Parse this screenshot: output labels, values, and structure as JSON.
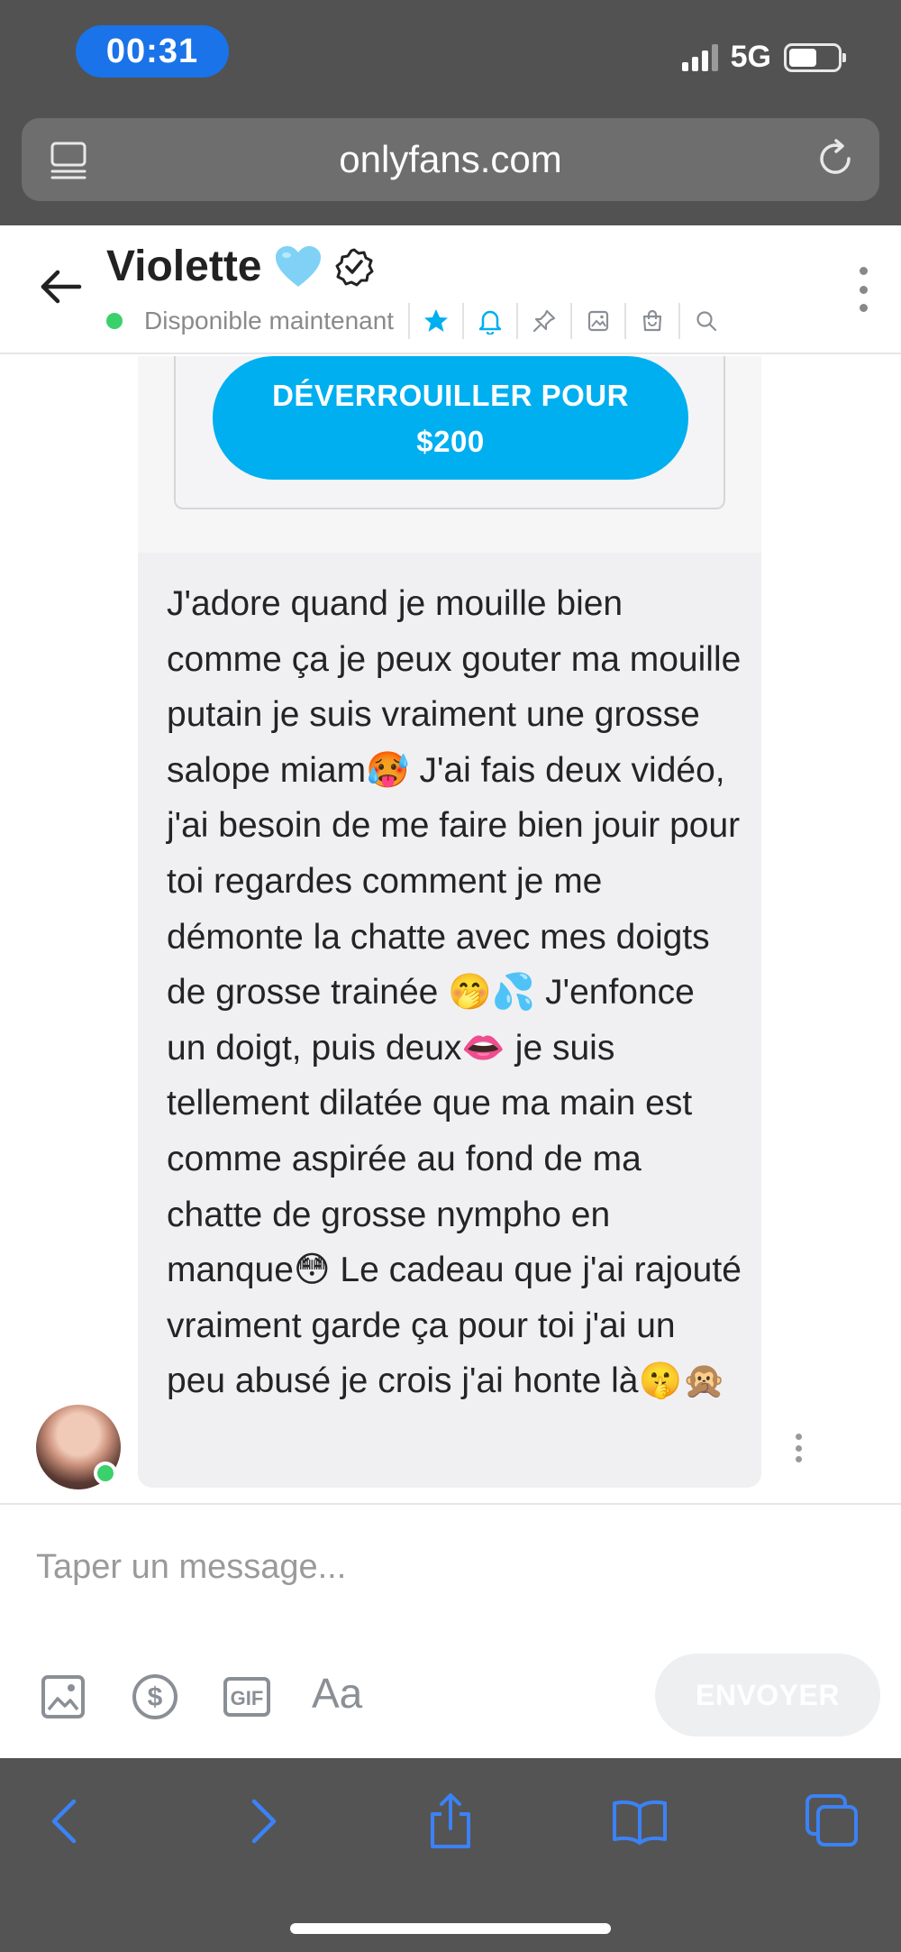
{
  "status_bar": {
    "time": "00:31",
    "network": "5G"
  },
  "browser": {
    "url": "onlyfans.com"
  },
  "chat_header": {
    "name": "Violette",
    "name_emoji": "🩵",
    "status": "Disponible maintenant",
    "icons": [
      "star-icon",
      "bell-icon",
      "pin-icon",
      "image-icon",
      "bag-icon",
      "search-icon"
    ]
  },
  "message": {
    "unlock_button_line1": "DÉVERROUILLER POUR",
    "unlock_button_line2": "$200",
    "text": "J'adore quand je mouille bien comme ça je peux gouter ma mouille putain je suis vraiment une grosse salope miam🥵 J'ai fais deux vidéo, j'ai besoin de me faire bien jouir pour toi regardes comment je me démonte la chatte avec mes doigts de grosse trainée 🤭💦 J'enfonce un doigt, puis deux👄 je suis tellement dilatée que ma main est comme aspirée au fond de ma chatte de grosse nympho en manque😳 Le cadeau que j'ai rajouté vraiment garde ça pour toi j'ai un peu abusé je crois j'ai honte là🤫🙊"
  },
  "composer": {
    "placeholder": "Taper un message...",
    "font_button": "Aa",
    "send_label": "ENVOYER",
    "tools": [
      "image-icon",
      "dollar-icon",
      "gif-icon",
      "text-format-icon"
    ]
  },
  "colors": {
    "accent": "#00aff0",
    "online": "#3ad16b",
    "browser_chrome": "#525252",
    "ios_blue": "#1a73e8"
  }
}
